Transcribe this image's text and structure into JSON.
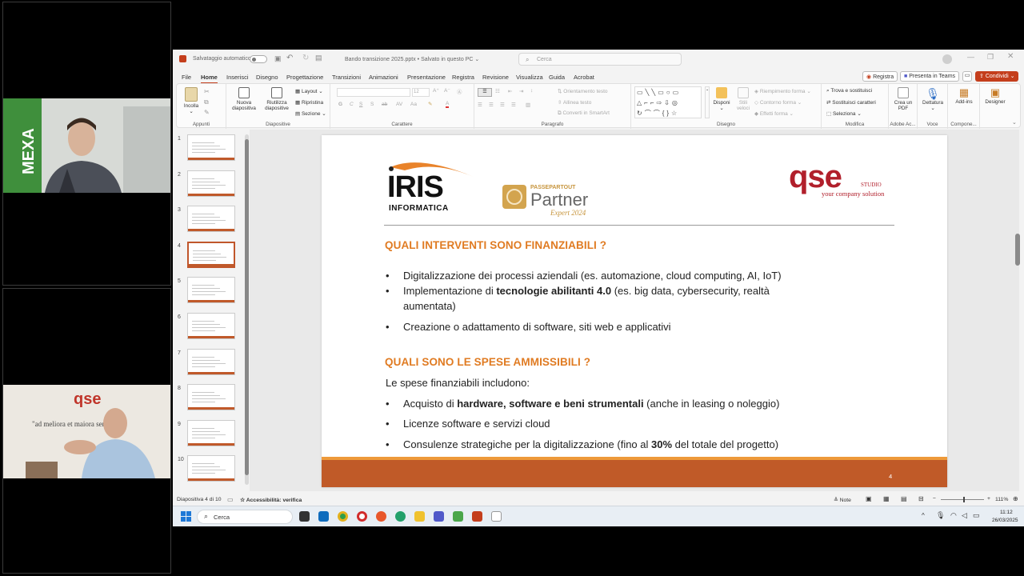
{
  "titlebar": {
    "autosave_label": "Salvataggio automatico",
    "file_title": "Bando transizione 2025.pptx • Salvato in questo PC ⌄",
    "search_placeholder": "Cerca"
  },
  "menu": {
    "tabs": [
      "File",
      "Home",
      "Inserisci",
      "Disegno",
      "Progettazione",
      "Transizioni",
      "Animazioni",
      "Presentazione",
      "Registra",
      "Revisione",
      "Visualizza",
      "Guida",
      "Acrobat"
    ],
    "active_tab": "Home",
    "record_label": "Registra",
    "present_teams_label": "Presenta in Teams",
    "share_label": "Condividi"
  },
  "ribbon": {
    "paste": "Incolla",
    "clipboard": "Appunti",
    "new_slide": "Nuova diapositiva",
    "reuse_slides": "Riutilizza diapositive",
    "layout": "Layout",
    "reset": "Ripristina",
    "section": "Sezione",
    "slides_group": "Diapositive",
    "font_group": "Carattere",
    "text_direction": "Orientamento testo",
    "align_text": "Allinea testo",
    "smartart": "Converti in SmartArt",
    "paragraph_group": "Paragrafo",
    "arrange": "Disponi",
    "quick_styles": "Stili veloci",
    "shape_fill": "Riempimento forma",
    "shape_outline": "Contorno forma",
    "shape_effects": "Effetti forma",
    "drawing_group": "Disegno",
    "find_replace": "Trova e sostituisci",
    "replace_fonts": "Sostituisci caratteri",
    "select": "Seleziona",
    "editing_group": "Modifica",
    "create_pdf": "Crea un PDF",
    "adobe_group": "Adobe Ac...",
    "dictate": "Dettatura",
    "voice_group": "Voce",
    "addins": "Add-ins",
    "addins_group": "Compone...",
    "designer": "Designer",
    "font_size": "12"
  },
  "thumbnails": [
    "1",
    "2",
    "3",
    "4",
    "5",
    "6",
    "7",
    "8",
    "9",
    "10"
  ],
  "slide": {
    "logo_iris": "IRIS",
    "logo_iris_sub": "INFORMATICA",
    "logo_pp_small": "PASSEPARTOUT",
    "logo_pp_big": "Partner",
    "logo_pp_expert": "Expert 2024",
    "logo_qse": "qse",
    "logo_qse_studio": "STUDIO",
    "logo_qse_tag": "your company solution",
    "heading1": "QUALI INTERVENTI SONO FINANZIABILI ?",
    "bullets1": [
      {
        "pre": "Digitalizzazione dei processi aziendali (es. automazione, cloud computing, AI, IoT)",
        "bold": "",
        "post": ""
      },
      {
        "pre": "Implementazione di ",
        "bold": "tecnologie abilitanti 4.0",
        "post": " (es. big data, cybersecurity, realtà aumentata)"
      },
      {
        "pre": "Creazione o adattamento di software, siti web e applicativi",
        "bold": "",
        "post": ""
      }
    ],
    "heading2": "QUALI SONO LE SPESE AMMISSIBILI ?",
    "intro2": "Le spese finanziabili includono:",
    "bullets2": [
      {
        "pre": "Acquisto di ",
        "bold": "hardware, software e beni strumentali",
        "post": " (anche in leasing o noleggio)"
      },
      {
        "pre": "Licenze software e servizi cloud",
        "bold": "",
        "post": ""
      },
      {
        "pre": "Consulenze strategiche per la digitalizzazione (fino al ",
        "bold": "30%",
        "post": " del totale del progetto)"
      }
    ],
    "bullet_char": "•",
    "page_number": "4"
  },
  "status": {
    "slide_of": "Diapositiva 4 di 10",
    "accessibility": "Accessibilità: verifica",
    "notes": "Note",
    "zoom": "111%"
  },
  "taskbar": {
    "search": "Cerca",
    "time": "11:12",
    "date": "26/03/2025"
  },
  "colors": {
    "accent_orange": "#e07b22",
    "footer_bar": "#c05a28",
    "share_button": "#c43e1c"
  }
}
